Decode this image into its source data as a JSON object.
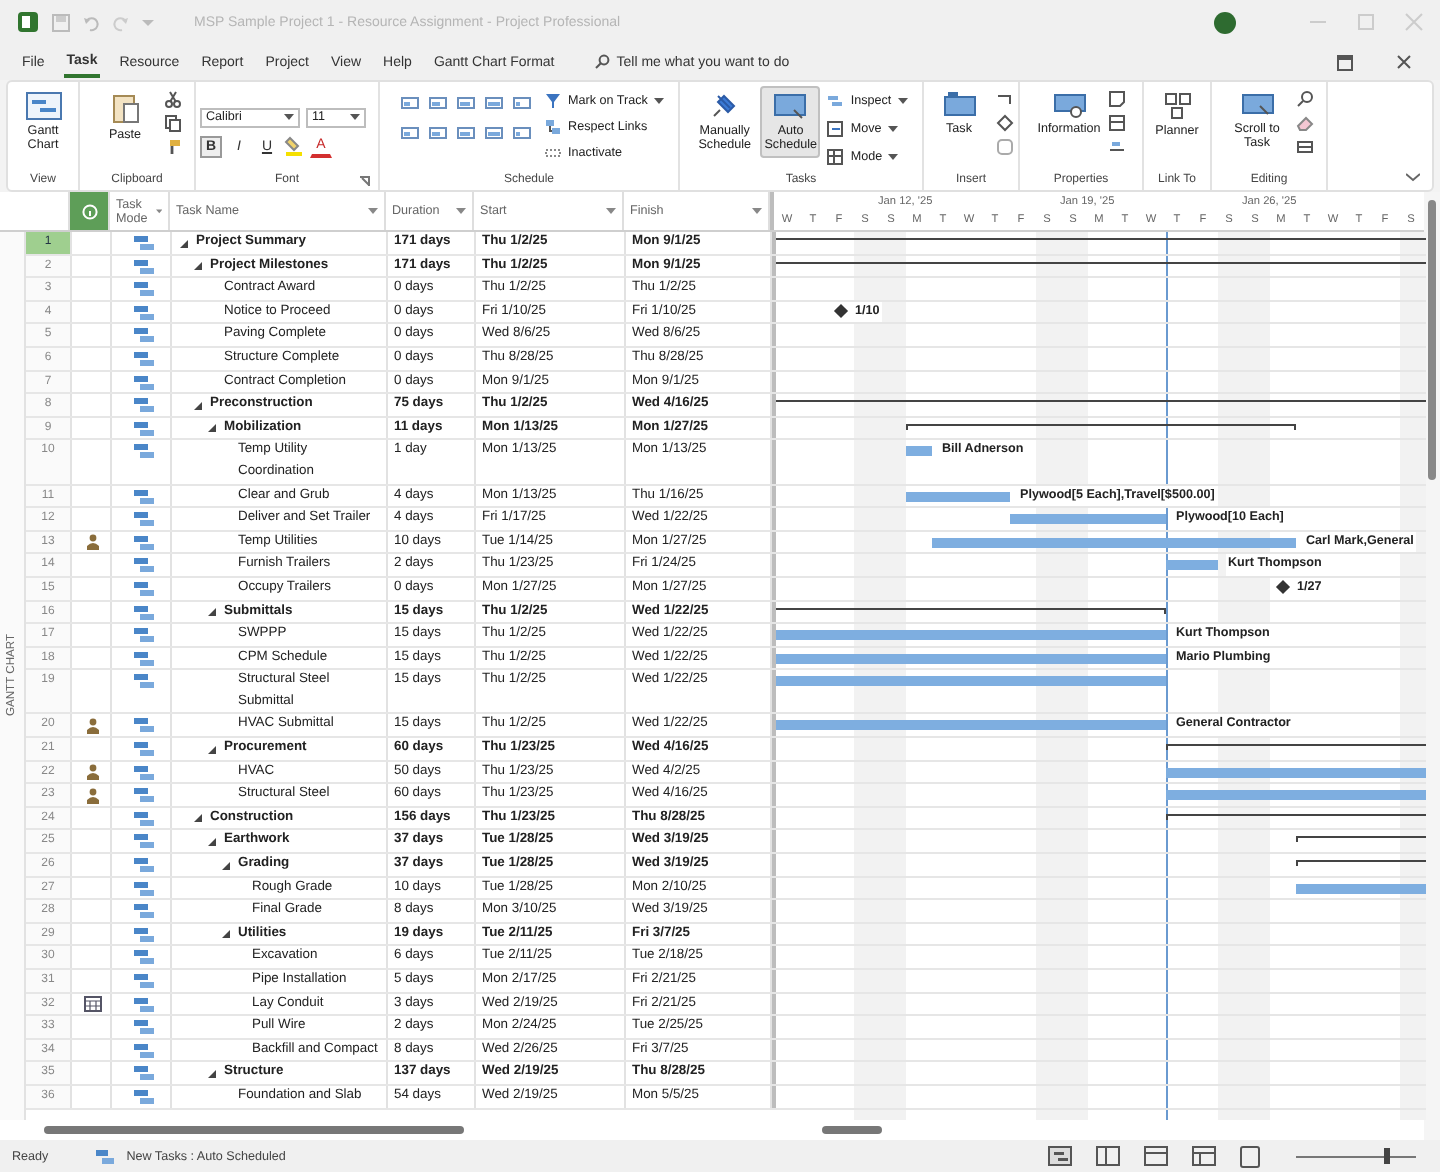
{
  "window": {
    "title": "MSP Sample Project 1 - Resource Assignment - Project Professional"
  },
  "menu_tabs": [
    {
      "label": "File",
      "selected": false
    },
    {
      "label": "Task",
      "selected": true
    },
    {
      "label": "Resource",
      "selected": false
    },
    {
      "label": "Report",
      "selected": false
    },
    {
      "label": "Project",
      "selected": false
    },
    {
      "label": "View",
      "selected": false
    },
    {
      "label": "Help",
      "selected": false
    },
    {
      "label": "Gantt Chart Format",
      "selected": false
    }
  ],
  "tell_me": {
    "placeholder": "Tell me what you want to do"
  },
  "ribbon": {
    "view": {
      "label": "View",
      "gantt_chart": "Gantt Chart"
    },
    "clipboard": {
      "label": "Clipboard",
      "paste": "Paste"
    },
    "font": {
      "label": "Font",
      "family": "Calibri",
      "size": "11",
      "bold": {
        "label": "B",
        "on": true
      },
      "italic": "I",
      "underline": "U",
      "font_color": "A"
    },
    "schedule": {
      "label": "Schedule",
      "mark_on_track": "Mark on Track",
      "respect_links": "Respect Links",
      "inactivate": "Inactivate"
    },
    "tasks": {
      "label": "Tasks",
      "modes": [
        {
          "label": "Manually Schedule",
          "selected": false
        },
        {
          "label": "Auto Schedule",
          "selected": true
        }
      ],
      "inspect": "Inspect",
      "move": "Move",
      "mode": "Mode"
    },
    "insert": {
      "label": "Insert",
      "task": "Task"
    },
    "properties": {
      "label": "Properties",
      "information": "Information"
    },
    "link_to": {
      "label": "Link To",
      "planner": "Planner"
    },
    "editing": {
      "label": "Editing",
      "scroll": "Scroll to Task"
    }
  },
  "side_label": "GANTT CHART",
  "table": {
    "columns": [
      "Task Mode",
      "Task Name",
      "Duration",
      "Start",
      "Finish"
    ],
    "tasks": [
      {
        "id": "1",
        "name": "Project Summary",
        "duration": "171 days",
        "start": "Thu 1/2/25",
        "finish": "Mon 9/1/25",
        "selected": true,
        "expanded": true,
        "children": [
          {
            "id": "2",
            "name": "Project Milestones",
            "duration": "171 days",
            "start": "Thu 1/2/25",
            "finish": "Mon 9/1/25",
            "selected": false,
            "expanded": true,
            "children": [
              {
                "id": "3",
                "name": "Contract Award",
                "duration": "0 days",
                "start": "Thu 1/2/25",
                "finish": "Thu 1/2/25",
                "selected": false
              },
              {
                "id": "4",
                "name": "Notice to Proceed",
                "duration": "0 days",
                "start": "Fri 1/10/25",
                "finish": "Fri 1/10/25",
                "selected": false,
                "bar_label": "1/10"
              },
              {
                "id": "5",
                "name": "Paving Complete",
                "duration": "0 days",
                "start": "Wed 8/6/25",
                "finish": "Wed 8/6/25",
                "selected": false
              },
              {
                "id": "6",
                "name": "Structure Complete",
                "duration": "0 days",
                "start": "Thu 8/28/25",
                "finish": "Thu 8/28/25",
                "selected": false
              },
              {
                "id": "7",
                "name": "Contract Completion",
                "duration": "0 days",
                "start": "Mon 9/1/25",
                "finish": "Mon 9/1/25",
                "selected": false
              }
            ]
          },
          {
            "id": "8",
            "name": "Preconstruction",
            "duration": "75 days",
            "start": "Thu 1/2/25",
            "finish": "Wed 4/16/25",
            "selected": false,
            "expanded": true,
            "children": [
              {
                "id": "9",
                "name": "Mobilization",
                "duration": "11 days",
                "start": "Mon 1/13/25",
                "finish": "Mon 1/27/25",
                "selected": false,
                "expanded": true,
                "children": [
                  {
                    "id": "10",
                    "name": "Temp Utility Coordination",
                    "duration": "1 day",
                    "start": "Mon 1/13/25",
                    "finish": "Mon 1/13/25",
                    "selected": false,
                    "bar_label": "Bill Adnerson"
                  },
                  {
                    "id": "11",
                    "name": "Clear and Grub",
                    "duration": "4 days",
                    "start": "Mon 1/13/25",
                    "finish": "Thu 1/16/25",
                    "selected": false,
                    "bar_label": "Plywood[5 Each],Travel[$500.00]"
                  },
                  {
                    "id": "12",
                    "name": "Deliver and Set Trailer",
                    "duration": "4 days",
                    "start": "Fri 1/17/25",
                    "finish": "Wed 1/22/25",
                    "selected": false,
                    "bar_label": "Plywood[10 Each]"
                  },
                  {
                    "id": "13",
                    "name": "Temp Utilities",
                    "duration": "10 days",
                    "start": "Tue 1/14/25",
                    "finish": "Mon 1/27/25",
                    "selected": false,
                    "kind": "assigned",
                    "bar_label": "Carl Mark,General"
                  },
                  {
                    "id": "14",
                    "name": "Furnish Trailers",
                    "duration": "2 days",
                    "start": "Thu 1/23/25",
                    "finish": "Fri 1/24/25",
                    "selected": false,
                    "bar_label": "Kurt Thompson"
                  },
                  {
                    "id": "15",
                    "name": "Occupy Trailers",
                    "duration": "0 days",
                    "start": "Mon 1/27/25",
                    "finish": "Mon 1/27/25",
                    "selected": false,
                    "bar_label": "1/27"
                  }
                ]
              },
              {
                "id": "16",
                "name": "Submittals",
                "duration": "15 days",
                "start": "Thu 1/2/25",
                "finish": "Wed 1/22/25",
                "selected": false,
                "expanded": true,
                "children": [
                  {
                    "id": "17",
                    "name": "SWPPP",
                    "duration": "15 days",
                    "start": "Thu 1/2/25",
                    "finish": "Wed 1/22/25",
                    "selected": false,
                    "bar_label": "Kurt Thompson"
                  },
                  {
                    "id": "18",
                    "name": "CPM Schedule",
                    "duration": "15 days",
                    "start": "Thu 1/2/25",
                    "finish": "Wed 1/22/25",
                    "selected": false,
                    "bar_label": "Mario Plumbing"
                  },
                  {
                    "id": "19",
                    "name": "Structural Steel Submittal",
                    "duration": "15 days",
                    "start": "Thu 1/2/25",
                    "finish": "Wed 1/22/25",
                    "selected": false
                  },
                  {
                    "id": "20",
                    "name": "HVAC Submittal",
                    "duration": "15 days",
                    "start": "Thu 1/2/25",
                    "finish": "Wed 1/22/25",
                    "selected": false,
                    "kind": "assigned",
                    "bar_label": "General Contractor"
                  }
                ]
              },
              {
                "id": "21",
                "name": "Procurement",
                "duration": "60 days",
                "start": "Thu 1/23/25",
                "finish": "Wed 4/16/25",
                "selected": false,
                "expanded": true,
                "children": [
                  {
                    "id": "22",
                    "name": "HVAC",
                    "duration": "50 days",
                    "start": "Thu 1/23/25",
                    "finish": "Wed 4/2/25",
                    "selected": false,
                    "kind": "assigned"
                  },
                  {
                    "id": "23",
                    "name": "Structural Steel",
                    "duration": "60 days",
                    "start": "Thu 1/23/25",
                    "finish": "Wed 4/16/25",
                    "selected": false,
                    "kind": "assigned"
                  }
                ]
              }
            ]
          },
          {
            "id": "24",
            "name": "Construction",
            "duration": "156 days",
            "start": "Thu 1/23/25",
            "finish": "Thu 8/28/25",
            "selected": false,
            "expanded": true,
            "children": [
              {
                "id": "25",
                "name": "Earthwork",
                "duration": "37 days",
                "start": "Tue 1/28/25",
                "finish": "Wed 3/19/25",
                "selected": false,
                "expanded": true,
                "children": [
                  {
                    "id": "26",
                    "name": "Grading",
                    "duration": "37 days",
                    "start": "Tue 1/28/25",
                    "finish": "Wed 3/19/25",
                    "selected": false,
                    "expanded": true,
                    "children": [
                      {
                        "id": "27",
                        "name": "Rough Grade",
                        "duration": "10 days",
                        "start": "Tue 1/28/25",
                        "finish": "Mon 2/10/25",
                        "selected": false
                      },
                      {
                        "id": "28",
                        "name": "Final Grade",
                        "duration": "8 days",
                        "start": "Mon 3/10/25",
                        "finish": "Wed 3/19/25",
                        "selected": false
                      }
                    ]
                  },
                  {
                    "id": "29",
                    "name": "Utilities",
                    "duration": "19 days",
                    "start": "Tue 2/11/25",
                    "finish": "Fri 3/7/25",
                    "selected": false,
                    "expanded": true,
                    "children": [
                      {
                        "id": "30",
                        "name": "Excavation",
                        "duration": "6 days",
                        "start": "Tue 2/11/25",
                        "finish": "Tue 2/18/25",
                        "selected": false
                      },
                      {
                        "id": "31",
                        "name": "Pipe Installation",
                        "duration": "5 days",
                        "start": "Mon 2/17/25",
                        "finish": "Fri 2/21/25",
                        "selected": false
                      },
                      {
                        "id": "32",
                        "name": "Lay Conduit",
                        "duration": "3 days",
                        "start": "Wed 2/19/25",
                        "finish": "Fri 2/21/25",
                        "selected": false,
                        "kind": "calendared"
                      },
                      {
                        "id": "33",
                        "name": "Pull Wire",
                        "duration": "2 days",
                        "start": "Mon 2/24/25",
                        "finish": "Tue 2/25/25",
                        "selected": false
                      },
                      {
                        "id": "34",
                        "name": "Backfill and Compact",
                        "duration": "8 days",
                        "start": "Wed 2/26/25",
                        "finish": "Fri 3/7/25",
                        "selected": false
                      }
                    ]
                  }
                ]
              },
              {
                "id": "35",
                "name": "Structure",
                "duration": "137 days",
                "start": "Wed 2/19/25",
                "finish": "Thu 8/28/25",
                "selected": false,
                "expanded": true,
                "children": [
                  {
                    "id": "36",
                    "name": "Foundation and Slab",
                    "duration": "54 days",
                    "start": "Wed 2/19/25",
                    "finish": "Mon 5/5/25",
                    "selected": false
                  }
                ]
              }
            ]
          }
        ]
      }
    ]
  },
  "timescale": {
    "weeks": [
      "Jan 12, '25",
      "Jan 19, '25",
      "Jan 26, '25"
    ],
    "days": [
      "W",
      "T",
      "F",
      "S",
      "S",
      "M",
      "T",
      "W",
      "T",
      "F",
      "S",
      "S",
      "M",
      "T",
      "W",
      "T",
      "F",
      "S",
      "S",
      "M",
      "T",
      "W",
      "T",
      "F",
      "S"
    ]
  },
  "status_bar": {
    "ready": "Ready",
    "new_tasks": "New Tasks : Auto Scheduled",
    "zoom": {
      "level": 0.75
    }
  }
}
